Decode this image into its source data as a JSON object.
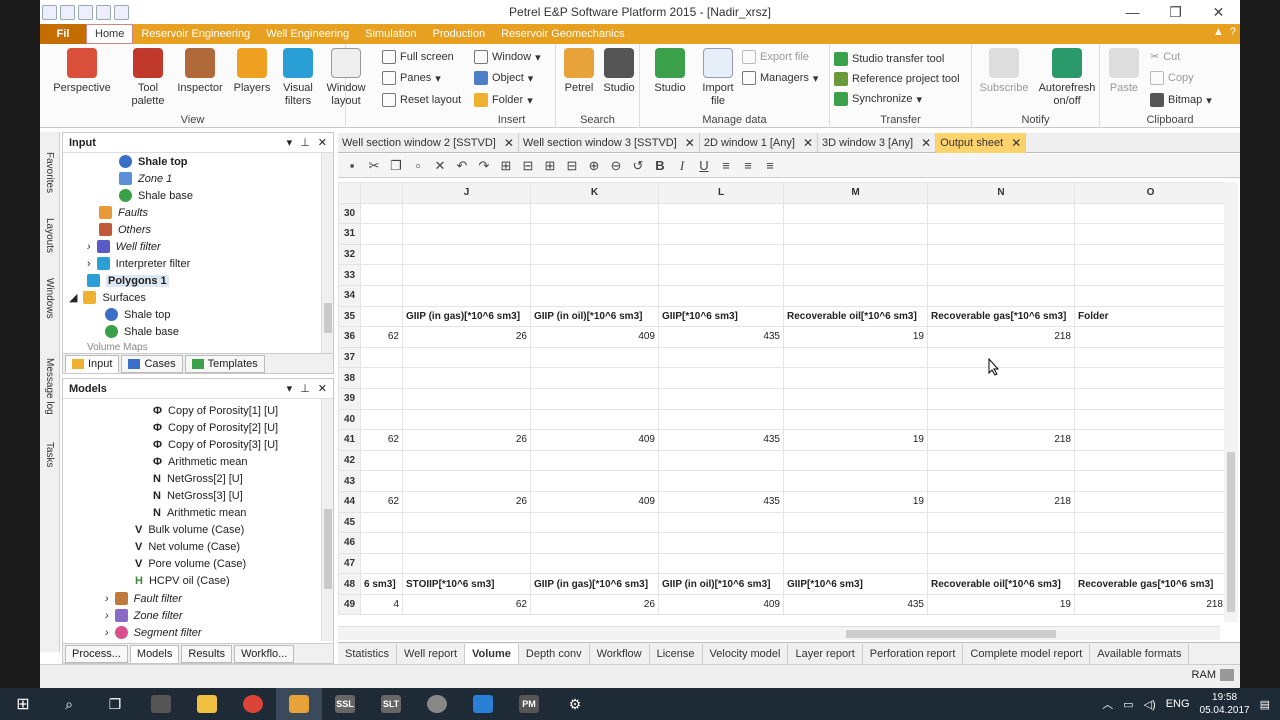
{
  "window": {
    "title": "Petrel E&P Software Platform 2015 - [Nadir_xrsz]",
    "minimize": "—",
    "maximize": "❐",
    "close": "✕"
  },
  "menu": {
    "file": "Fil",
    "tabs": [
      "Home",
      "Reservoir Engineering",
      "Well Engineering",
      "Simulation",
      "Production",
      "Reservoir Geomechanics"
    ]
  },
  "ribbon": {
    "perspective": "Perspective",
    "tool_palette": "Tool palette",
    "inspector": "Inspector",
    "players": "Players",
    "visual_filters": "Visual filters",
    "window_layout": "Window layout",
    "full_screen": "Full screen",
    "panes": "Panes",
    "reset_layout": "Reset layout",
    "view_group": "View",
    "window": "Window",
    "object": "Object",
    "folder": "Folder",
    "insert_group": "Insert",
    "petrel": "Petrel",
    "studio_search": "Studio",
    "search_group": "Search",
    "studio_manage": "Studio",
    "import_file": "Import file",
    "export_file": "Export file",
    "managers": "Managers",
    "manage_group": "Manage data",
    "studio_transfer_tool": "Studio transfer tool",
    "reference_project_tool": "Reference project tool",
    "synchronize": "Synchronize",
    "transfer_group": "Transfer",
    "subscribe": "Subscribe",
    "autorefresh": "Autorefresh on/off",
    "notify_group": "Notify",
    "paste": "Paste",
    "cut": "Cut",
    "copy": "Copy",
    "bitmap": "Bitmap",
    "clipboard_group": "Clipboard"
  },
  "side_strip": [
    "Favorites",
    "Layouts",
    "Windows",
    "Message log",
    "Tasks"
  ],
  "input_pane": {
    "title": "Input",
    "items": [
      "Shale top",
      "Zone 1",
      "Shale base",
      "Faults",
      "Others",
      "Well filter",
      "Interpreter filter",
      "Polygons 1",
      "Surfaces",
      "Shale top",
      "Shale base",
      "Volume Maps"
    ],
    "tabs": [
      "Input",
      "Cases",
      "Templates"
    ]
  },
  "models_pane": {
    "title": "Models",
    "items": [
      "Copy of Porosity[1] [U]",
      "Copy of Porosity[2] [U]",
      "Copy of Porosity[3] [U]",
      "Arithmetic mean",
      "NetGross[2] [U]",
      "NetGross[3] [U]",
      "Arithmetic mean",
      "Bulk volume (Case)",
      "Net volume (Case)",
      "Pore volume (Case)",
      "HCPV oil (Case)",
      "Fault filter",
      "Zone filter",
      "Segment filter"
    ],
    "tabs": [
      "Process...",
      "Models",
      "Results",
      "Workflo..."
    ]
  },
  "doc_tabs": [
    "Well section window 2 [SSTVD]",
    "Well section window 3 [SSTVD]",
    "2D window 1 [Any]",
    "3D window 3 [Any]",
    "Output sheet"
  ],
  "sheet": {
    "columns": [
      "",
      "J",
      "K",
      "L",
      "M",
      "N",
      "O"
    ],
    "rows": [
      {
        "n": "30",
        "cells": [
          "",
          "",
          "",
          "",
          "",
          "",
          ""
        ]
      },
      {
        "n": "31",
        "cells": [
          "",
          "",
          "",
          "",
          "",
          "",
          ""
        ]
      },
      {
        "n": "32",
        "cells": [
          "",
          "",
          "",
          "",
          "",
          "",
          ""
        ]
      },
      {
        "n": "33",
        "cells": [
          "",
          "",
          "",
          "",
          "",
          "",
          ""
        ]
      },
      {
        "n": "34",
        "cells": [
          "",
          "",
          "",
          "",
          "",
          "",
          ""
        ]
      },
      {
        "n": "35",
        "cells": [
          "",
          "GIIP (in gas)[*10^6 sm3]",
          "GIIP (in oil)[*10^6 sm3]",
          "GIIP[*10^6 sm3]",
          "Recoverable oil[*10^6 sm3]",
          "Recoverable gas[*10^6 sm3]",
          "Folder"
        ],
        "hdr": true
      },
      {
        "n": "36",
        "cells": [
          "62",
          "26",
          "409",
          "435",
          "19",
          "218",
          ""
        ]
      },
      {
        "n": "37",
        "cells": [
          "",
          "",
          "",
          "",
          "",
          "",
          ""
        ]
      },
      {
        "n": "38",
        "cells": [
          "",
          "",
          "",
          "",
          "",
          "",
          ""
        ]
      },
      {
        "n": "39",
        "cells": [
          "",
          "",
          "",
          "",
          "",
          "",
          ""
        ]
      },
      {
        "n": "40",
        "cells": [
          "",
          "",
          "",
          "",
          "",
          "",
          ""
        ]
      },
      {
        "n": "41",
        "cells": [
          "62",
          "26",
          "409",
          "435",
          "19",
          "218",
          ""
        ]
      },
      {
        "n": "42",
        "cells": [
          "",
          "",
          "",
          "",
          "",
          "",
          ""
        ]
      },
      {
        "n": "43",
        "cells": [
          "",
          "",
          "",
          "",
          "",
          "",
          ""
        ]
      },
      {
        "n": "44",
        "cells": [
          "62",
          "26",
          "409",
          "435",
          "19",
          "218",
          ""
        ]
      },
      {
        "n": "45",
        "cells": [
          "",
          "",
          "",
          "",
          "",
          "",
          ""
        ]
      },
      {
        "n": "46",
        "cells": [
          "",
          "",
          "",
          "",
          "",
          "",
          ""
        ]
      },
      {
        "n": "47",
        "cells": [
          "",
          "",
          "",
          "",
          "",
          "",
          ""
        ]
      },
      {
        "n": "48",
        "cells": [
          "6 sm3]",
          "STOIIP[*10^6 sm3]",
          "GIIP (in gas)[*10^6 sm3]",
          "GIIP (in oil)[*10^6 sm3]",
          "GIIP[*10^6 sm3]",
          "Recoverable oil[*10^6 sm3]",
          "Recoverable gas[*10^6 sm3]"
        ],
        "hdr": true
      },
      {
        "n": "49",
        "cells": [
          "4",
          "62",
          "26",
          "409",
          "435",
          "19",
          "218"
        ]
      }
    ]
  },
  "sheet_tabs": [
    "Statistics",
    "Well report",
    "Volume",
    "Depth conv",
    "Workflow",
    "License",
    "Velocity model",
    "Layer report",
    "Perforation report",
    "Complete model report",
    "Available formats"
  ],
  "status": {
    "ram": "RAM"
  },
  "taskbar": {
    "lang": "ENG",
    "time": "19:58",
    "date": "05.04.2017"
  }
}
